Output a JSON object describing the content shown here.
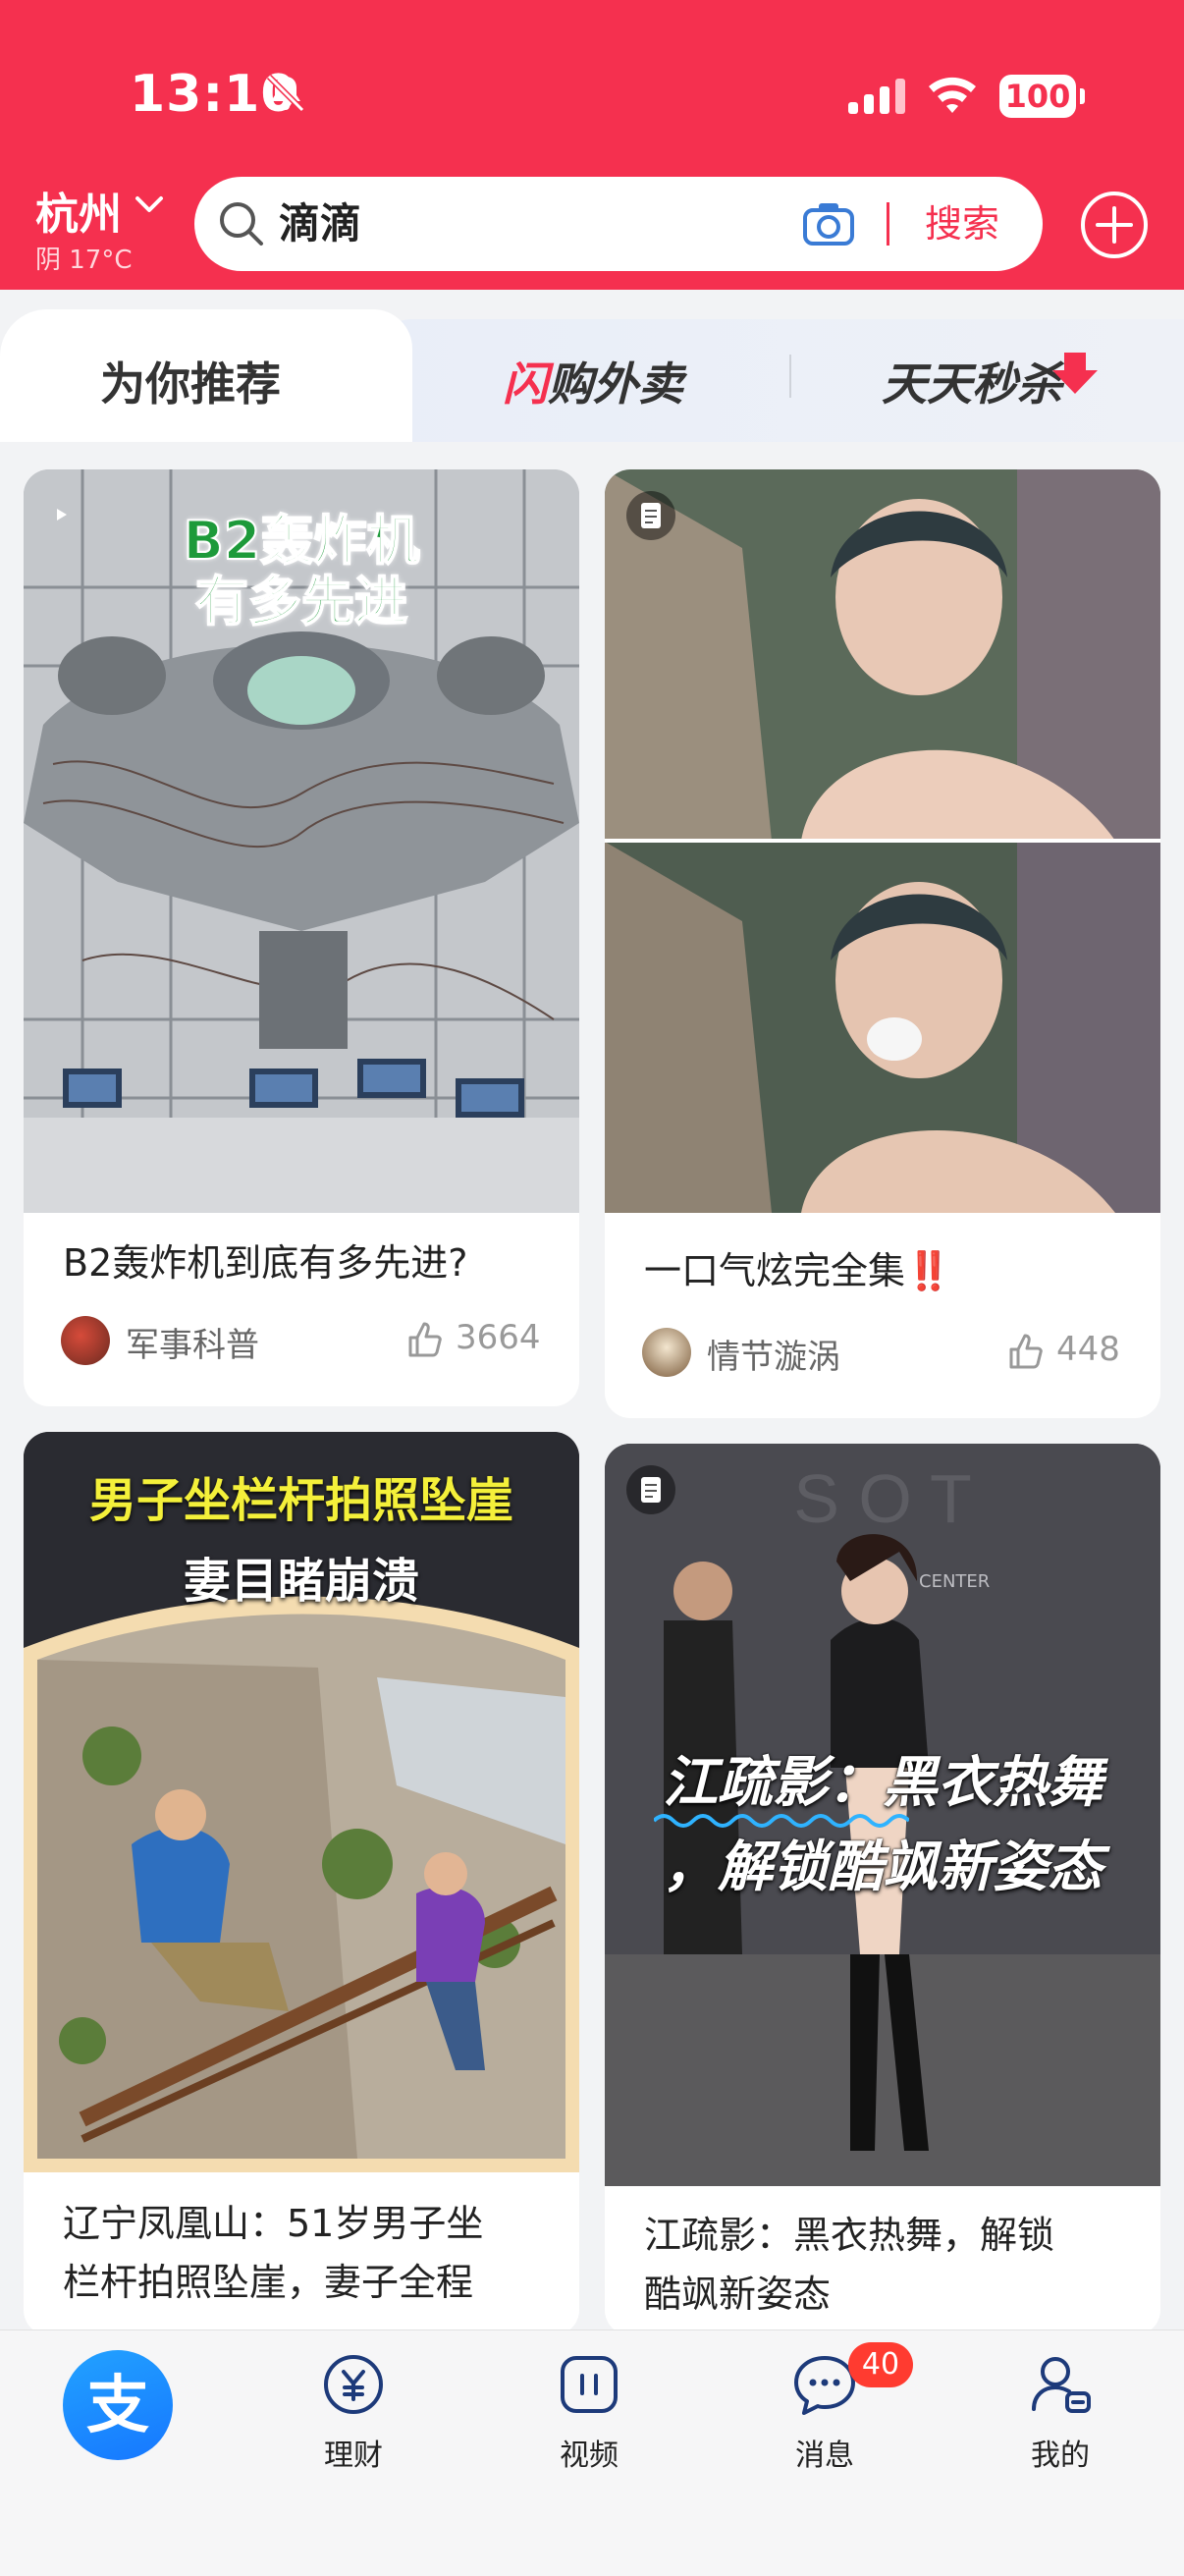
{
  "status_bar": {
    "time": "13:10",
    "battery": "100"
  },
  "header": {
    "city": "杭州",
    "weather": "阴 17°C",
    "search": {
      "value": "滴滴",
      "button": "搜索"
    }
  },
  "tabs": [
    {
      "label": "为你推荐"
    },
    {
      "label_accent": "闪",
      "label_rest": "购外卖"
    },
    {
      "label": "天天秒杀"
    }
  ],
  "feed": {
    "cards": [
      {
        "overlay_line1": "B2轰炸机",
        "overlay_line2": "有多先进",
        "title": "B2轰炸机到底有多先进?",
        "author": "军事科普",
        "likes": "3664",
        "media": "video"
      },
      {
        "title": "一口气炫完全集‼️",
        "author": "情节漩涡",
        "likes": "448",
        "media": "article"
      },
      {
        "overlay_line1": "男子坐栏杆拍照坠崖",
        "overlay_line2": "妻目睹崩溃",
        "title_line1": "辽宁凤凰山：51岁男子坐",
        "title_line2": "栏杆拍照坠崖，妻子全程",
        "media": "video"
      },
      {
        "overlay_sign": "CENTER",
        "overlay_line1": "江疏影：黑衣热舞",
        "overlay_line2": "，解锁酷飒新姿态",
        "title_line1": "江疏影：黑衣热舞，解锁",
        "title_line2": "酷飒新姿态",
        "media": "article"
      }
    ]
  },
  "bottom_nav": {
    "items": [
      {
        "label": "理财"
      },
      {
        "label": "视频"
      },
      {
        "label": "消息"
      },
      {
        "label": "我的"
      }
    ],
    "message_badge": "40"
  }
}
